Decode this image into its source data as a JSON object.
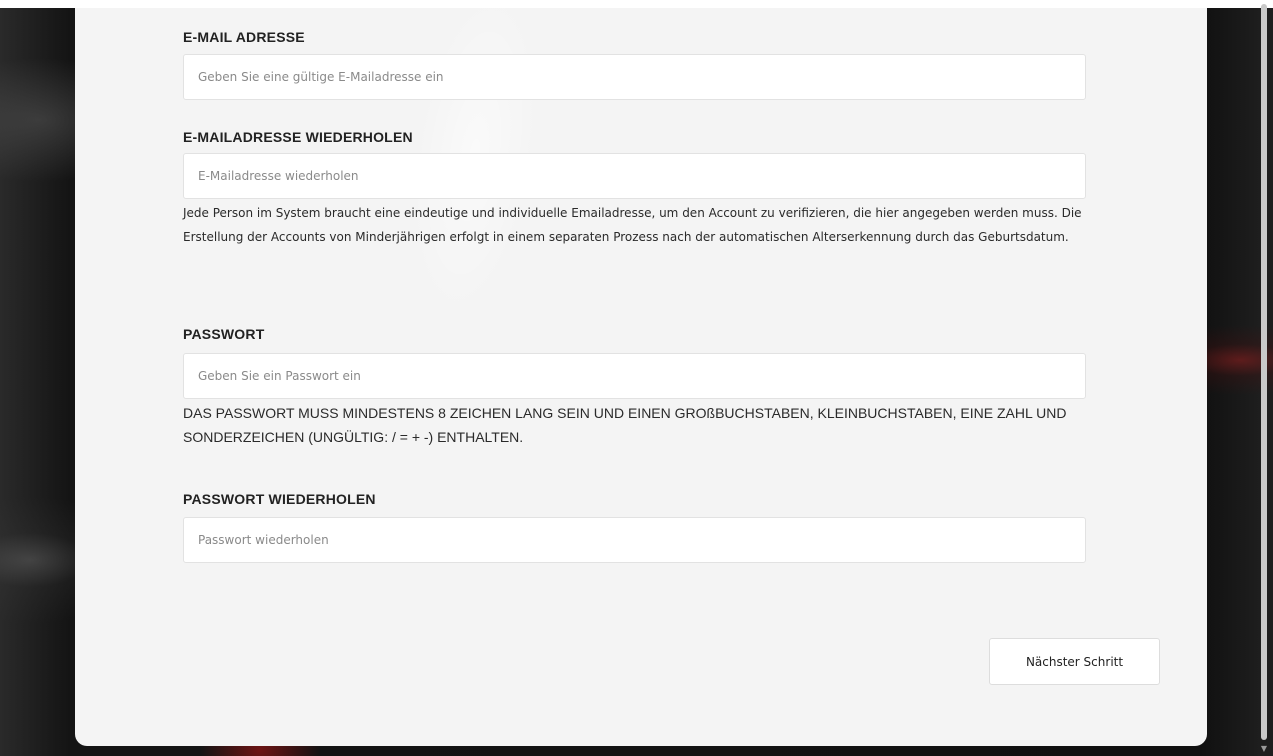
{
  "form": {
    "email": {
      "label": "E-MAIL ADRESSE",
      "placeholder": "Geben Sie eine gültige E-Mailadresse ein",
      "value": ""
    },
    "email_repeat": {
      "label": "E-MAILADRESSE WIEDERHOLEN",
      "placeholder": "E-Mailadresse wiederholen",
      "value": "",
      "help": "Jede Person im System braucht eine eindeutige und individuelle Emailadresse, um den Account zu verifizieren, die hier angegeben werden muss. Die Erstellung der Accounts von Minderjährigen erfolgt in einem separaten Prozess nach der automatischen Alterserkennung durch das Geburtsdatum."
    },
    "password": {
      "label": "PASSWORT",
      "placeholder": "Geben Sie ein Passwort ein",
      "value": "",
      "rules": "DAS PASSWORT MUSS MINDESTENS 8 ZEICHEN LANG SEIN UND EINEN GROßBUCHSTABEN, KLEINBUCHSTABEN, EINE ZAHL UND SONDERZEICHEN (UNGÜLTIG: / = + -) ENTHALTEN."
    },
    "password_repeat": {
      "label": "PASSWORT WIEDERHOLEN",
      "placeholder": "Passwort wiederholen",
      "value": ""
    },
    "next_button_label": "Nächster Schritt"
  },
  "icons": {
    "scroll_down": "scroll-down-arrow-icon"
  }
}
